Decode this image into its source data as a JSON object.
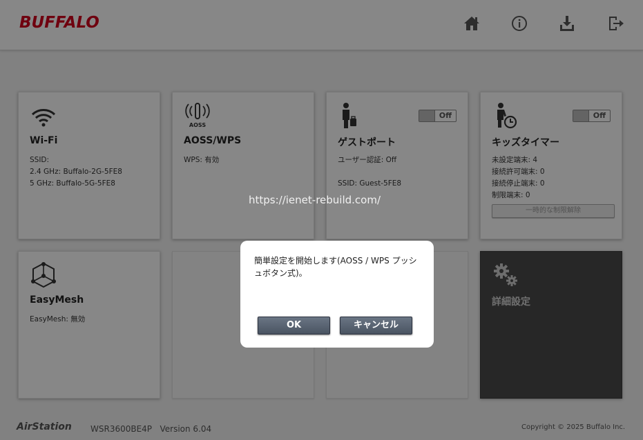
{
  "header": {
    "logo": "BUFFALO",
    "icons": [
      "home-icon",
      "info-icon",
      "download-icon",
      "logout-icon"
    ]
  },
  "cards": {
    "wifi": {
      "icon": "wifi-icon",
      "title": "Wi-Fi",
      "ssid_label": "SSID:",
      "ssid_24": "2.4 GHz: Buffalo-2G-5FE8",
      "ssid_5": "5 GHz: Buffalo-5G-5FE8"
    },
    "aoss": {
      "icon": "aoss-icon",
      "icon_text": "AOSS",
      "title": "AOSS/WPS",
      "status": "WPS: 有効"
    },
    "guest": {
      "icon": "guest-person-icon",
      "title": "ゲストポート",
      "toggle": "Off",
      "auth": "ユーザー認証: Off",
      "ssid": "SSID: Guest-5FE8"
    },
    "kids": {
      "icon": "kid-timer-icon",
      "title": "キッズタイマー",
      "toggle": "Off",
      "unset": "未設定端末: 4",
      "allowed": "接続許可端末: 0",
      "stopped": "接続停止端末: 0",
      "limited": "制限端末: 0",
      "temp_release_button": "一時的な制限解除"
    },
    "easymesh": {
      "icon": "mesh-icon",
      "title": "EasyMesh",
      "status": "EasyMesh: 無効"
    },
    "advanced": {
      "icon": "gears-icon",
      "title": "詳細設定"
    }
  },
  "footer": {
    "brand": "AirStation",
    "model": "WSR3600BE4P   Version 6.04",
    "copyright": "Copyright © 2025 Buffalo Inc."
  },
  "watermark": "https://ienet-rebuild.com/",
  "dialog": {
    "message": "簡単設定を開始します(AOSS / WPS プッシュボタン式)。",
    "ok_label": "OK",
    "cancel_label": "キャンセル"
  }
}
